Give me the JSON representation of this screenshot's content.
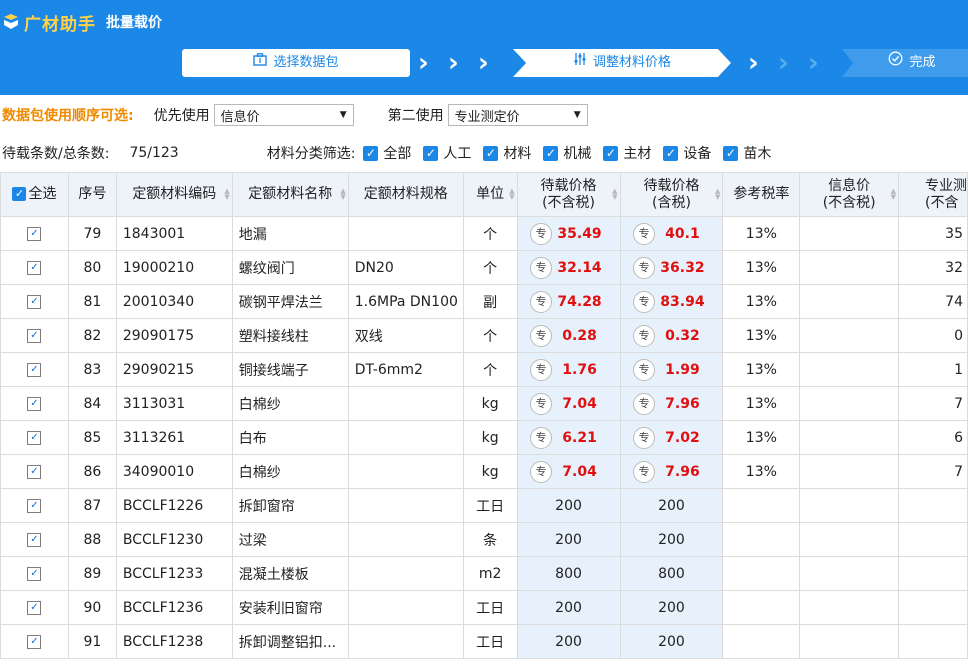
{
  "header": {
    "app_name": "广材助手",
    "subtitle": "批量载价",
    "steps": [
      {
        "label": "选择数据包",
        "icon": "briefcase-icon"
      },
      {
        "label": "调整材料价格",
        "icon": "sliders-icon"
      },
      {
        "label": "完成",
        "icon": "check-circle-icon"
      }
    ]
  },
  "options": {
    "title": "数据包使用顺序可选:",
    "first_label": "优先使用",
    "first_value": "信息价",
    "second_label": "第二使用",
    "second_value": "专业测定价"
  },
  "filter": {
    "count_label": "待载条数/总条数:",
    "count_value": "75/123",
    "filter_label": "材料分类筛选:",
    "items": [
      "全部",
      "人工",
      "材料",
      "机械",
      "主材",
      "设备",
      "苗木"
    ]
  },
  "table": {
    "headers": {
      "select_all": "全选",
      "seq": "序号",
      "code": "定额材料编码",
      "name": "定额材料名称",
      "spec": "定额材料规格",
      "unit": "单位",
      "price_ex": "待载价格\n(不含税)",
      "price_in": "待载价格\n(含税)",
      "tax": "参考税率",
      "info": "信息价\n(不含税)",
      "pro": "专业测\n(不含"
    },
    "tag_label": "专",
    "rows": [
      {
        "seq": "79",
        "code": "1843001",
        "name": "地漏",
        "spec": "",
        "unit": "个",
        "price_ex": "35.49",
        "price_in": "40.1",
        "tax": "13%",
        "info": "",
        "pro": "35",
        "has_tag": true
      },
      {
        "seq": "80",
        "code": "19000210",
        "name": "螺纹阀门",
        "spec": "DN20",
        "unit": "个",
        "price_ex": "32.14",
        "price_in": "36.32",
        "tax": "13%",
        "info": "",
        "pro": "32",
        "has_tag": true
      },
      {
        "seq": "81",
        "code": "20010340",
        "name": "碳钢平焊法兰",
        "spec": "1.6MPa DN100",
        "unit": "副",
        "price_ex": "74.28",
        "price_in": "83.94",
        "tax": "13%",
        "info": "",
        "pro": "74",
        "has_tag": true
      },
      {
        "seq": "82",
        "code": "29090175",
        "name": "塑料接线柱",
        "spec": "双线",
        "unit": "个",
        "price_ex": "0.28",
        "price_in": "0.32",
        "tax": "13%",
        "info": "",
        "pro": "0",
        "has_tag": true
      },
      {
        "seq": "83",
        "code": "29090215",
        "name": "铜接线端子",
        "spec": "DT-6mm2",
        "unit": "个",
        "price_ex": "1.76",
        "price_in": "1.99",
        "tax": "13%",
        "info": "",
        "pro": "1",
        "has_tag": true
      },
      {
        "seq": "84",
        "code": "3113031",
        "name": "白棉纱",
        "spec": "",
        "unit": "kg",
        "price_ex": "7.04",
        "price_in": "7.96",
        "tax": "13%",
        "info": "",
        "pro": "7",
        "has_tag": true
      },
      {
        "seq": "85",
        "code": "3113261",
        "name": "白布",
        "spec": "",
        "unit": "kg",
        "price_ex": "6.21",
        "price_in": "7.02",
        "tax": "13%",
        "info": "",
        "pro": "6",
        "has_tag": true
      },
      {
        "seq": "86",
        "code": "34090010",
        "name": "白棉纱",
        "spec": "",
        "unit": "kg",
        "price_ex": "7.04",
        "price_in": "7.96",
        "tax": "13%",
        "info": "",
        "pro": "7",
        "has_tag": true
      },
      {
        "seq": "87",
        "code": "BCCLF1226",
        "name": "拆卸窗帘",
        "spec": "",
        "unit": "工日",
        "price_ex": "200",
        "price_in": "200",
        "tax": "",
        "info": "",
        "pro": "",
        "has_tag": false
      },
      {
        "seq": "88",
        "code": "BCCLF1230",
        "name": "过梁",
        "spec": "",
        "unit": "条",
        "price_ex": "200",
        "price_in": "200",
        "tax": "",
        "info": "",
        "pro": "",
        "has_tag": false
      },
      {
        "seq": "89",
        "code": "BCCLF1233",
        "name": "混凝土楼板",
        "spec": "",
        "unit": "m2",
        "price_ex": "800",
        "price_in": "800",
        "tax": "",
        "info": "",
        "pro": "",
        "has_tag": false
      },
      {
        "seq": "90",
        "code": "BCCLF1236",
        "name": "安装利旧窗帘",
        "spec": "",
        "unit": "工日",
        "price_ex": "200",
        "price_in": "200",
        "tax": "",
        "info": "",
        "pro": "",
        "has_tag": false
      },
      {
        "seq": "91",
        "code": "BCCLF1238",
        "name": "拆卸调整铝扣...",
        "spec": "",
        "unit": "工日",
        "price_ex": "200",
        "price_in": "200",
        "tax": "",
        "info": "",
        "pro": "",
        "has_tag": false
      }
    ]
  },
  "colors": {
    "header_bg": "#1b87e6",
    "accent_yellow": "#ffd24a",
    "option_title": "#f08a00",
    "price_red": "#e01010",
    "price_col_bg": "#e6f1fb"
  }
}
